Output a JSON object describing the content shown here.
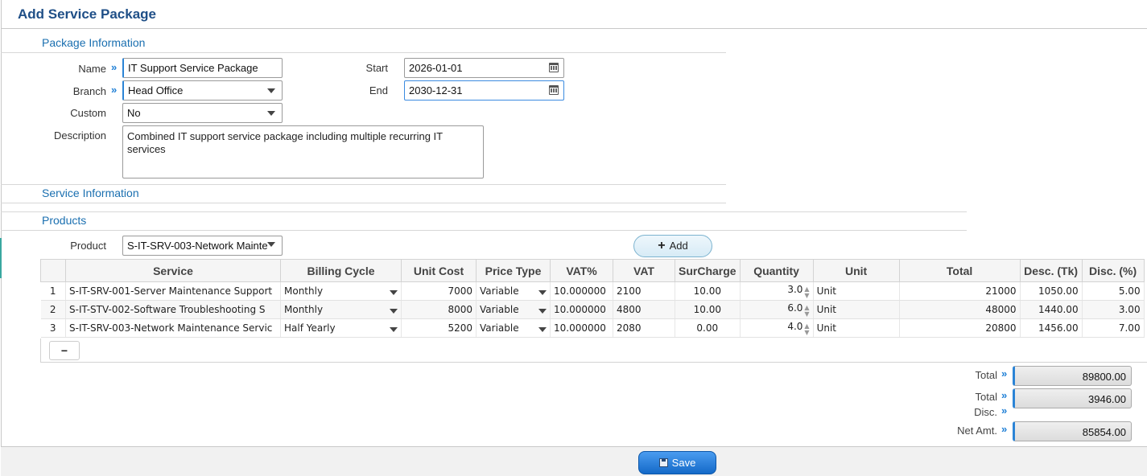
{
  "page": {
    "title": "Add Service Package"
  },
  "sections": {
    "package_info": "Package Information",
    "service_info": "Service Information",
    "products": "Products"
  },
  "form": {
    "name_label": "Name",
    "name_value": "IT Support Service Package",
    "branch_label": "Branch",
    "branch_value": "Head Office",
    "custom_label": "Custom",
    "custom_value": "No",
    "description_label": "Description",
    "description_value": "Combined IT support service package including multiple recurring IT services",
    "start_label": "Start",
    "start_value": "2026-01-01",
    "end_label": "End",
    "end_value": "2030-12-31",
    "product_label": "Product",
    "product_value": "S-IT-SRV-003-Network Mainte",
    "add_label": "Add"
  },
  "table": {
    "columns": [
      "",
      "Service",
      "Billing Cycle",
      "Unit Cost",
      "Price Type",
      "VAT%",
      "VAT",
      "SurCharge",
      "Quantity",
      "Unit",
      "Total",
      "Desc. (Tk)",
      "Disc. (%)"
    ],
    "rows": [
      {
        "n": "1",
        "service": "S-IT-SRV-001-Server Maintenance Support",
        "billing": "Monthly",
        "unit_cost": "7000",
        "price_type": "Variable",
        "vat_pct": "10.000000",
        "vat": "2100",
        "surcharge": "10.00",
        "quantity": "3.0",
        "unit": "Unit",
        "total": "21000",
        "desc_tk": "1050.00",
        "disc_pct": "5.00"
      },
      {
        "n": "2",
        "service": "S-IT-STV-002-Software Troubleshooting S",
        "billing": "Monthly",
        "unit_cost": "8000",
        "price_type": "Variable",
        "vat_pct": "10.000000",
        "vat": "4800",
        "surcharge": "10.00",
        "quantity": "6.0",
        "unit": "Unit",
        "total": "48000",
        "desc_tk": "1440.00",
        "disc_pct": "3.00"
      },
      {
        "n": "3",
        "service": "S-IT-SRV-003-Network Maintenance Servic",
        "billing": "Half Yearly",
        "unit_cost": "5200",
        "price_type": "Variable",
        "vat_pct": "10.000000",
        "vat": "2080",
        "surcharge": "0.00",
        "quantity": "4.0",
        "unit": "Unit",
        "total": "20800",
        "desc_tk": "1456.00",
        "disc_pct": "7.00"
      }
    ],
    "remove_label": "−"
  },
  "totals": {
    "total_label": "Total",
    "total_value": "89800.00",
    "disc_label_1": "Total",
    "disc_label_2": "Disc.",
    "disc_value": "3946.00",
    "net_label": "Net Amt.",
    "net_value": "85854.00"
  },
  "footer": {
    "save_label": "Save"
  },
  "icons": {
    "required": "double-chevron-right-icon",
    "date": "calendar-icon",
    "dropdown": "chevron-down-icon",
    "add": "plus-icon",
    "save": "floppy-disk-icon"
  },
  "colors": {
    "title": "#1f4f87",
    "section": "#1a6fb0",
    "accent": "#2b84d6",
    "save_button": "#1469c8"
  }
}
